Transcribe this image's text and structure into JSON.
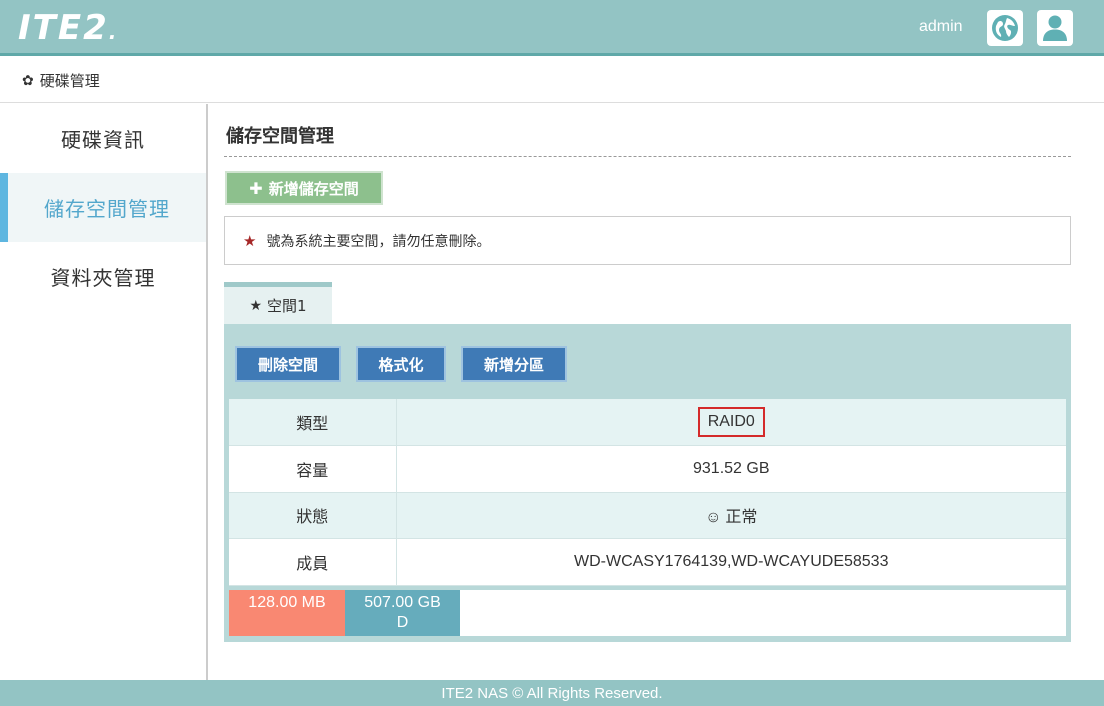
{
  "header": {
    "logo_text": "ITE2",
    "logo_dot": ".",
    "username": "admin",
    "brand_color": "#93c4c4",
    "icons": [
      "globe-icon",
      "user-icon"
    ]
  },
  "breadcrumb": {
    "icon": "gear-icon",
    "label": "硬碟管理"
  },
  "sidebar": {
    "items": [
      {
        "label": "硬碟資訊",
        "active": false
      },
      {
        "label": "儲存空間管理",
        "active": true
      },
      {
        "label": "資料夾管理",
        "active": false
      }
    ],
    "active_color": "#53a7cc"
  },
  "main": {
    "title": "儲存空間管理",
    "add_button": {
      "icon": "plus-icon",
      "label": "新增儲存空間"
    },
    "notice": {
      "icon": "star-icon",
      "text": "號為系統主要空間，請勿任意刪除。"
    },
    "tabs": [
      {
        "icon": "star-icon",
        "label": "空間1"
      }
    ],
    "actions": {
      "delete": "刪除空間",
      "format": "格式化",
      "add_partition": "新增分區"
    },
    "table": {
      "rows": [
        {
          "label": "類型",
          "value": "RAID0"
        },
        {
          "label": "容量",
          "value": "931.52 GB"
        },
        {
          "label": "狀態",
          "icon": "smile-icon",
          "value": "正常"
        },
        {
          "label": "成員",
          "value": "WD-WCASY1764139,WD-WCAYUDE58533"
        }
      ]
    },
    "usage": {
      "segments": [
        {
          "size": "128.00 MB",
          "name": "",
          "color": "#f98872"
        },
        {
          "size": "507.00 GB",
          "name": "D",
          "color": "#66acbc"
        }
      ]
    }
  },
  "footer": {
    "text": "ITE2 NAS © All Rights Reserved."
  }
}
